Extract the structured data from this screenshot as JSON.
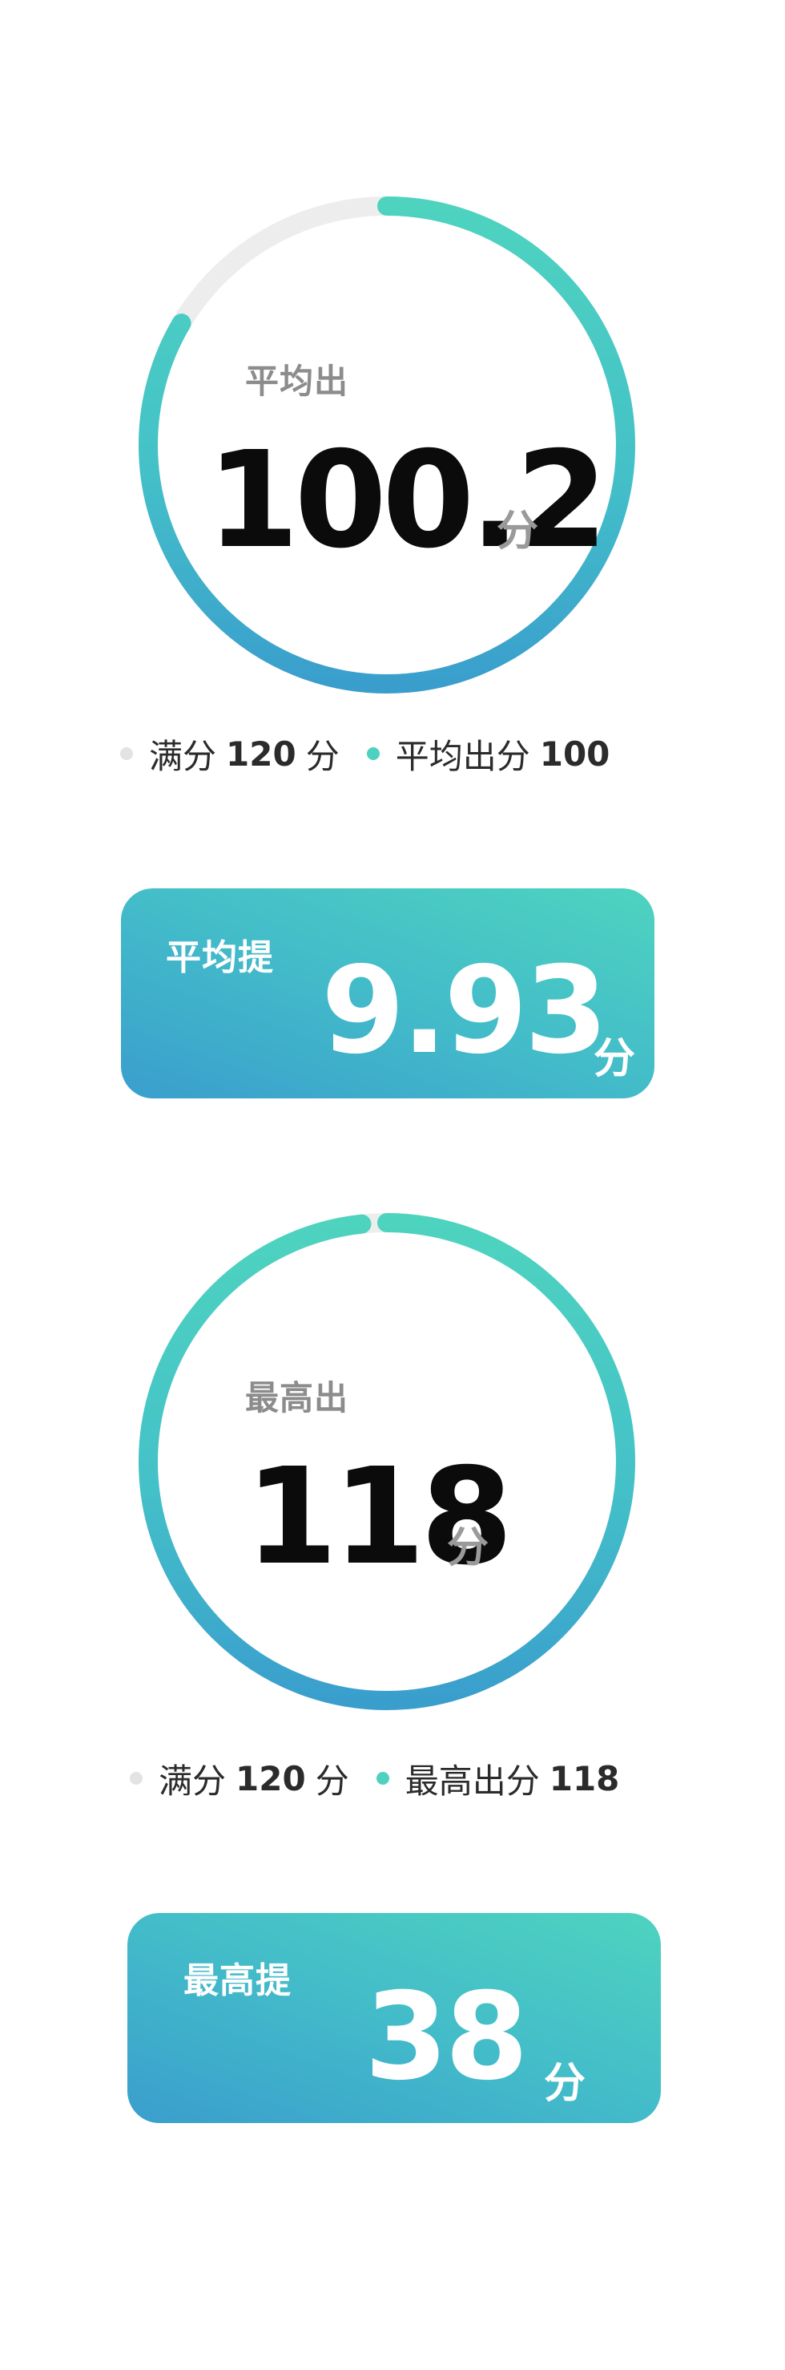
{
  "colors": {
    "track": "#ededed",
    "gradient_start": "#3a9ecd",
    "gradient_end": "#4ed3bf",
    "dot_grey": "#e3e3e3",
    "dot_teal": "#4fd1c0"
  },
  "average_score": {
    "label": "平均出",
    "value": "100.2",
    "unit": "分",
    "progress": 0.835,
    "legend": {
      "full_label": "满分",
      "full_value": "120",
      "full_unit": "分",
      "item_label": "平均出分",
      "item_value": "100"
    }
  },
  "average_improve": {
    "label": "平均提",
    "value": "9.93",
    "unit": "分"
  },
  "highest_score": {
    "label": "最高出",
    "value": "118",
    "unit": "分",
    "progress": 0.983,
    "legend": {
      "full_label": "满分",
      "full_value": "120",
      "full_unit": "分",
      "item_label": "最高出分",
      "item_value": "118"
    }
  },
  "highest_improve": {
    "label": "最高提",
    "value": "38",
    "unit": "分"
  }
}
